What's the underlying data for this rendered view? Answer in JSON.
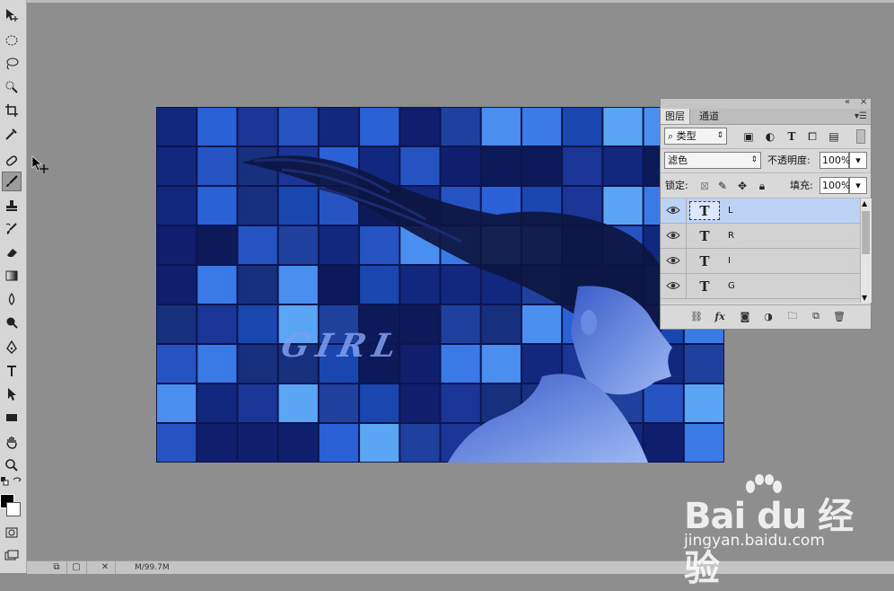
{
  "toolbar": {
    "tools": [
      "move-tool",
      "marquee-tool",
      "lasso-tool",
      "quick-select-tool",
      "crop-tool",
      "eyedropper-tool",
      "healing-brush-tool",
      "brush-tool",
      "clone-stamp-tool",
      "history-brush-tool",
      "eraser-tool",
      "gradient-tool",
      "blur-tool",
      "dodge-tool",
      "pen-tool",
      "type-tool",
      "path-select-tool",
      "rectangle-tool",
      "hand-tool",
      "zoom-tool"
    ],
    "active_tool": "brush-tool",
    "foreground_color": "#000000",
    "background_color": "#ffffff"
  },
  "canvas": {
    "overlay_text": "GIRL"
  },
  "layers_panel": {
    "tabs": [
      {
        "label": "图层",
        "active": true
      },
      {
        "label": "通道",
        "active": false
      }
    ],
    "filter_kind": "类型",
    "blend_mode": "滤色",
    "opacity_label": "不透明度:",
    "opacity_value": "100%",
    "lock_label": "锁定:",
    "fill_label": "填充:",
    "fill_value": "100%",
    "layers": [
      {
        "name": "L",
        "type_icon": "T",
        "selected": true
      },
      {
        "name": "R",
        "type_icon": "T",
        "selected": false
      },
      {
        "name": "I",
        "type_icon": "T",
        "selected": false
      },
      {
        "name": "G",
        "type_icon": "T",
        "selected": false
      }
    ]
  },
  "statusbar": {
    "text": "M/99.7M"
  },
  "watermark": {
    "brand": "Bai du 经验",
    "url": "jingyan.baidu.com"
  },
  "colors": {
    "workspace": "#8e8e8e",
    "selection": "#bcd3f5",
    "mosaic_blue": "#1c3fa8"
  }
}
